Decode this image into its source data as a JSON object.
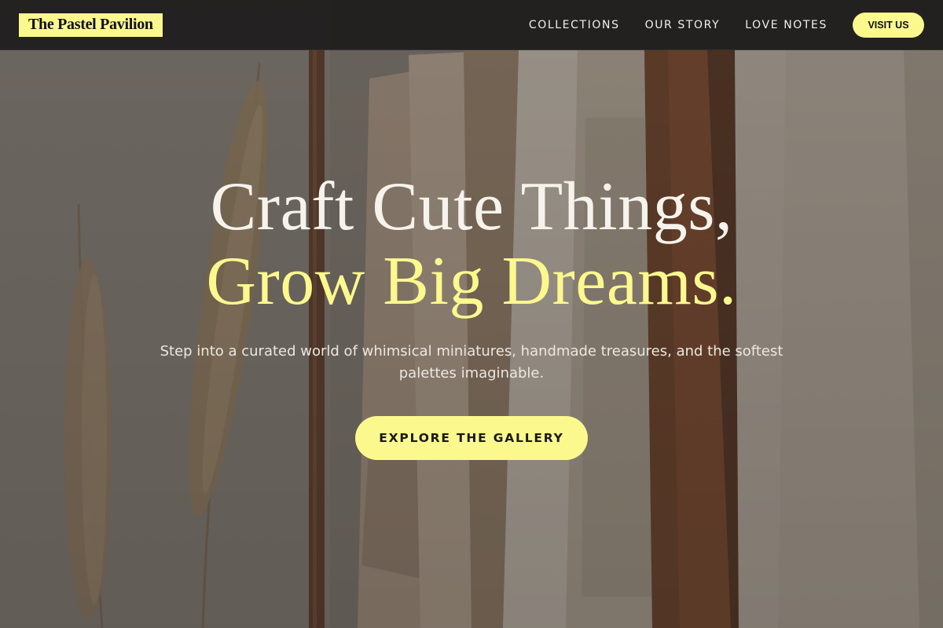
{
  "brand": {
    "name": "The Pastel Pavilion"
  },
  "nav": {
    "links": [
      "COLLECTIONS",
      "OUR STORY",
      "LOVE NOTES"
    ],
    "visit_label": "VISIT US"
  },
  "hero": {
    "headline_line1": "Craft Cute Things,",
    "headline_line2": "Grow Big Dreams.",
    "subtitle": "Step into a curated world of whimsical miniatures, handmade treasures, and the softest palettes imaginable.",
    "cta_label": "EXPLORE THE GALLERY"
  },
  "colors": {
    "accent": "#fbf88e",
    "navbar_bg": "#1e1c1c",
    "headline_text": "#f6f3ec"
  },
  "icons": []
}
